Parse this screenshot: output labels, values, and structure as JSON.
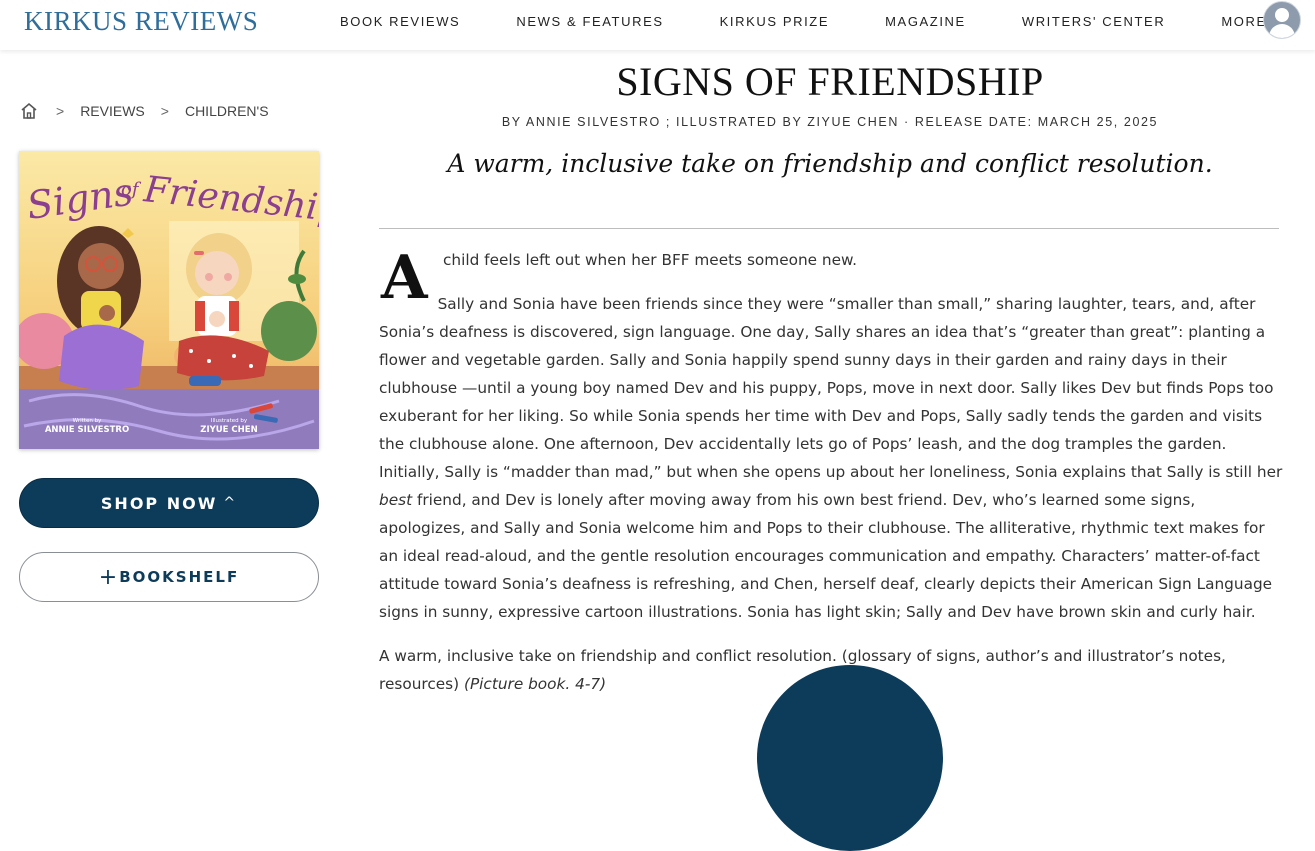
{
  "header": {
    "logo": "KIRKUS REVIEWS",
    "nav": [
      "BOOK REVIEWS",
      "NEWS & FEATURES",
      "KIRKUS PRIZE",
      "MAGAZINE",
      "WRITERS' CENTER",
      "MORE"
    ]
  },
  "breadcrumb": {
    "sep": ">",
    "items": [
      "REVIEWS",
      "CHILDREN'S"
    ]
  },
  "cover": {
    "title_line1": "Signs",
    "title_of": "of",
    "title_line2": "Friendship",
    "written_by": "Written by",
    "author": "ANNIE SILVESTRO",
    "illustrated_by": "Illustrated by",
    "illustrator": "ZIYUE CHEN"
  },
  "actions": {
    "shop": "SHOP NOW",
    "shop_caret": "^",
    "bookshelf_plus": "+",
    "bookshelf": "BOOKSHELF"
  },
  "book": {
    "title": "SIGNS OF FRIENDSHIP",
    "byline": "BY ANNIE SILVESTRO ; ILLUSTRATED BY ZIYUE CHEN · RELEASE DATE: MARCH 25, 2025",
    "pull_quote": "A warm, inclusive take on friendship and conflict resolution."
  },
  "review": {
    "dropcap": "A",
    "p1": "child feels left out when her BFF meets someone new.",
    "p2_a": "Sally and Sonia have been friends since they were “smaller than small,” sharing laughter, tears, and, after Sonia’s deafness is discovered, sign language. One day, Sally shares an idea that’s “greater than great”: planting a flower and vegetable garden. Sally and Sonia happily spend sunny days in their garden and rainy days in their clubhouse —until a young boy named Dev and his puppy, Pops, move in next door. Sally likes Dev but finds Pops too exuberant for her liking. So while Sonia spends her time with Dev and Pops, Sally sadly tends the garden and visits the clubhouse alone. One afternoon, Dev accidentally lets go of Pops’ leash, and the dog tramples the garden. Initially, Sally is “madder than mad,” but when she opens up about her loneliness, Sonia explains that Sally is still her",
    "p2_em": "best",
    "p2_b": "friend, and Dev is lonely after moving away from his own best friend. Dev, who’s learned some signs, apologizes, and Sally and Sonia welcome him and Pops to their clubhouse. The alliterative, rhythmic text makes for an ideal read-aloud, and the gentle resolution encourages communication and empathy. Characters’ matter-of-fact attitude toward Sonia’s deafness is refreshing, and Chen, herself deaf, clearly depicts their American Sign Language signs in sunny, expressive cartoon illustrations. Sonia has light skin; Sally and Dev have brown skin and curly hair.",
    "p3": "A warm, inclusive take on friendship and conflict resolution. (glossary of signs, author’s and illustrator’s notes, resources)",
    "p3_em": "(Picture book. 4-7)"
  },
  "colors": {
    "brand_blue": "#2f6d9b",
    "button_navy": "#0d3b5a"
  }
}
